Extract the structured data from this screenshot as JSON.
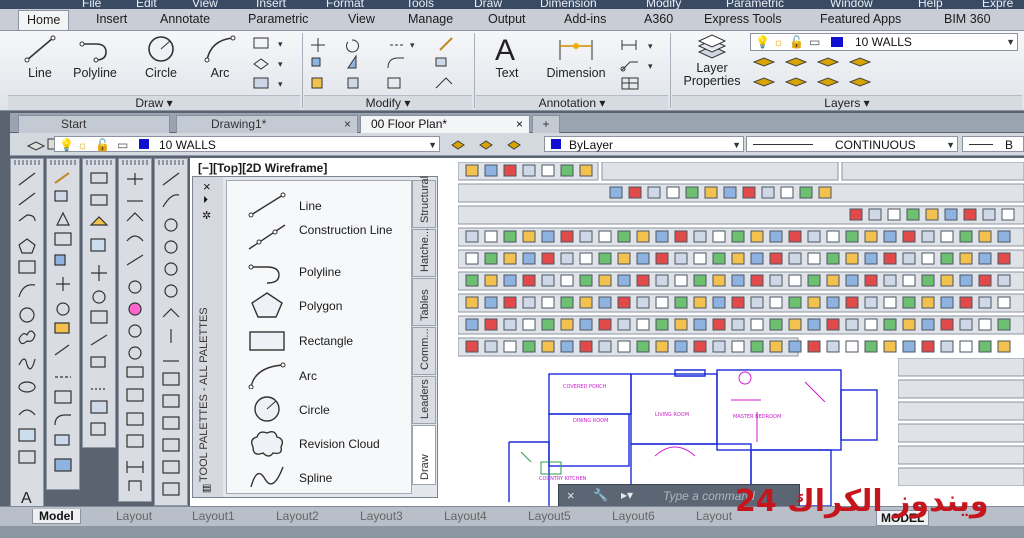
{
  "menubar": [
    "File",
    "Edit",
    "View",
    "Insert",
    "Format",
    "Tools",
    "Draw",
    "Dimension",
    "Modify",
    "Parametric",
    "Window",
    "Help",
    "Expre"
  ],
  "ribbon_tabs": [
    "Home",
    "Insert",
    "Annotate",
    "Parametric",
    "View",
    "Manage",
    "Output",
    "Add-ins",
    "A360",
    "Express Tools",
    "Featured Apps",
    "BIM 360"
  ],
  "draw_panel": {
    "title": "Draw",
    "buttons": [
      "Line",
      "Polyline",
      "Circle",
      "Arc"
    ]
  },
  "modify_panel": {
    "title": "Modify"
  },
  "annotation_panel": {
    "title": "Annotation",
    "buttons": [
      "Text",
      "Dimension"
    ]
  },
  "layers_panel": {
    "title": "Layers",
    "layer_properties": "Layer\nProperties",
    "current_layer": "10 WALLS"
  },
  "file_tabs": [
    "Start",
    "Drawing1*",
    "00 Floor Plan*"
  ],
  "propbar": {
    "layer": "10 WALLS",
    "color": "ByLayer",
    "linetype": "CONTINUOUS",
    "lineweight": "B"
  },
  "view_label": "[−][Top][2D Wireframe]",
  "palette": {
    "title": "TOOL PALETTES - ALL PALETTES",
    "tools": [
      "Line",
      "Construction Line",
      "Polyline",
      "Polygon",
      "Rectangle",
      "Arc",
      "Circle",
      "Revision Cloud",
      "Spline"
    ],
    "tabs": [
      "Structural",
      "Hatche...",
      "Tables",
      "Comm...",
      "Leaders",
      "Draw"
    ]
  },
  "command_placeholder": "Type a command",
  "plan_labels": [
    "COVERED PORCH",
    "DINING ROOM",
    "LIVING ROOM",
    "MASTER BEDROOM",
    "COUNTRY KITCHEN"
  ],
  "layout_tabs": [
    "Model",
    "Layout",
    "Layout1",
    "Layout2",
    "Layout3",
    "Layout4",
    "Layout5",
    "Layout6",
    "Layout"
  ],
  "status": {
    "model": "MODEL"
  },
  "watermark": "24 ويندوز الكراك"
}
